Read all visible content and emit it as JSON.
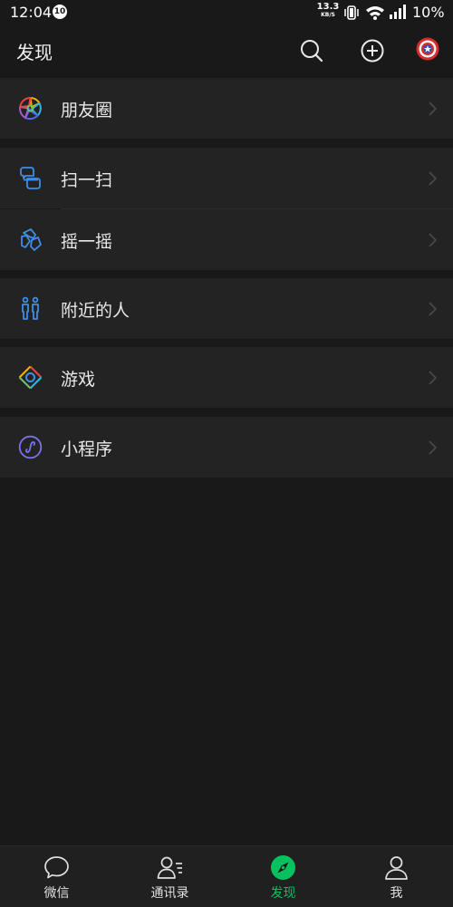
{
  "status_bar": {
    "time": "12:04",
    "notification_badge": "10",
    "net_speed_value": "13.3",
    "net_speed_unit": "KB/S",
    "battery": "10%"
  },
  "header": {
    "title": "发现",
    "icons": [
      "search-icon",
      "add-icon",
      "avatar"
    ]
  },
  "menu": {
    "moments": "朋友圈",
    "scan": "扫一扫",
    "shake": "摇一摇",
    "people_nearby": "附近的人",
    "games": "游戏",
    "mini_programs": "小程序"
  },
  "tabs": [
    {
      "label": "微信",
      "icon": "chat-bubble-icon"
    },
    {
      "label": "通讯录",
      "icon": "contacts-icon"
    },
    {
      "label": "发现",
      "icon": "compass-icon",
      "active": true
    },
    {
      "label": "我",
      "icon": "person-icon"
    }
  ],
  "colors": {
    "background": "#191919",
    "cell": "#232323",
    "accent": "#07c160",
    "blue_icon": "#3d8ee8"
  }
}
